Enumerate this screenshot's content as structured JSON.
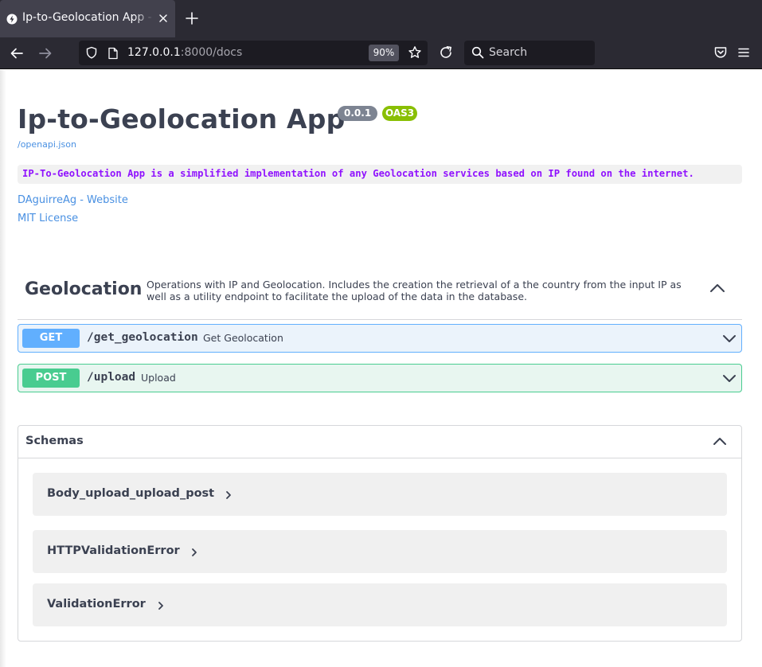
{
  "browser": {
    "tab_title": "Ip-to-Geolocation App - Swagger UI",
    "url_host": "127.0.0.1",
    "url_rest": ":8000/docs",
    "zoom": "90%",
    "search_placeholder": "Search"
  },
  "info": {
    "title": "Ip-to-Geolocation App",
    "version": "0.0.1",
    "spec_badge": "OAS3",
    "openapi_link": "/openapi.json",
    "description": "IP-To-Geolocation App is a simplified implementation of any Geolocation services based on IP found on the internet.",
    "contact_link": "DAguirreAg - Website",
    "license_link": "MIT License"
  },
  "tag": {
    "name": "Geolocation",
    "description": "Operations with IP and Geolocation. Includes the creation the retrieval of a the country from the input IP as well as a utility endpoint to facilitate the upload of the data in the database."
  },
  "operations": [
    {
      "method": "GET",
      "path": "/get_geolocation",
      "summary": "Get Geolocation",
      "color": "#61affe"
    },
    {
      "method": "POST",
      "path": "/upload",
      "summary": "Upload",
      "color": "#49cc90"
    }
  ],
  "schemas": {
    "title": "Schemas",
    "models": [
      {
        "name": "Body_upload_upload_post"
      },
      {
        "name": "HTTPValidationError"
      },
      {
        "name": "ValidationError"
      }
    ]
  }
}
